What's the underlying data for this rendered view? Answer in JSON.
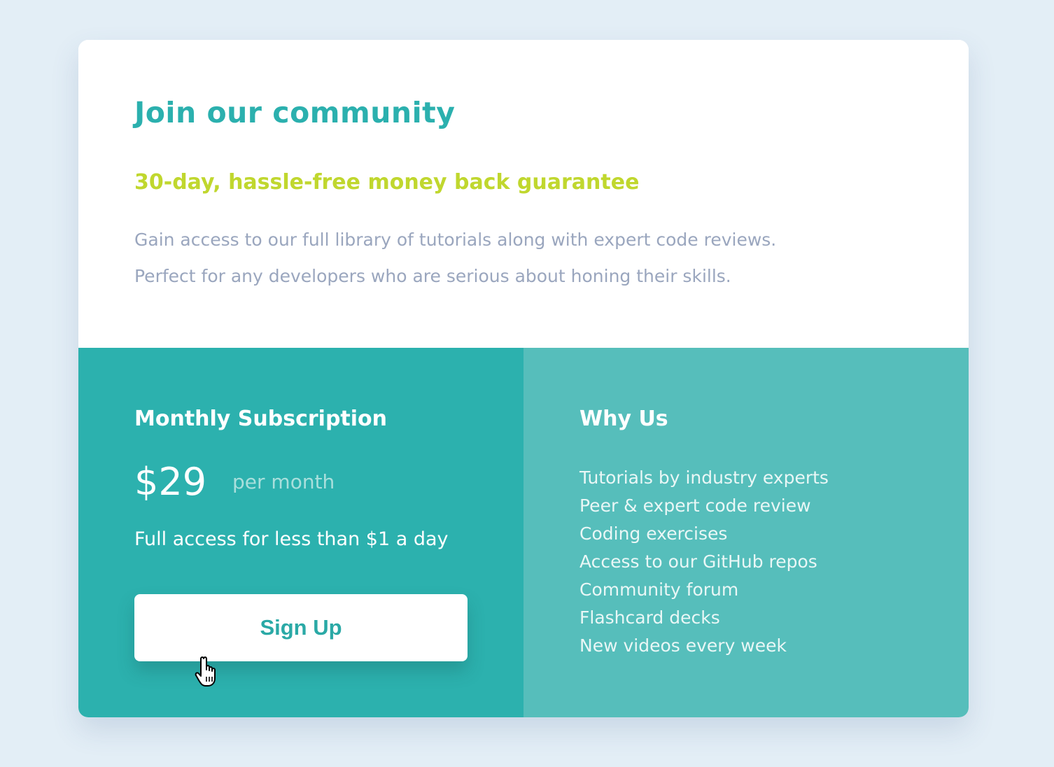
{
  "header": {
    "title": "Join our community",
    "guarantee": "30-day, hassle-free money back guarantee",
    "description_lines": [
      "Gain access to our full library of tutorials along with expert code reviews.",
      "Perfect for any developers who are serious about honing their skills."
    ]
  },
  "subscription": {
    "title": "Monthly Subscription",
    "price": "$29",
    "period": "per month",
    "note": "Full access for less than $1 a day",
    "button_label": "Sign Up"
  },
  "why_us": {
    "title": "Why Us",
    "items": [
      "Tutorials by industry experts",
      "Peer & expert code review",
      "Coding exercises",
      "Access to our GitHub repos",
      "Community forum",
      "Flashcard decks",
      "New videos every week"
    ]
  },
  "colors": {
    "page_background": "#e3eef6",
    "primary_teal": "#2cb1ae",
    "light_teal": "#56bebb",
    "accent_lime": "#c0d72e",
    "muted_text": "#9aa6be"
  },
  "icons": {
    "cursor": "hand-pointer-cursor-icon"
  }
}
